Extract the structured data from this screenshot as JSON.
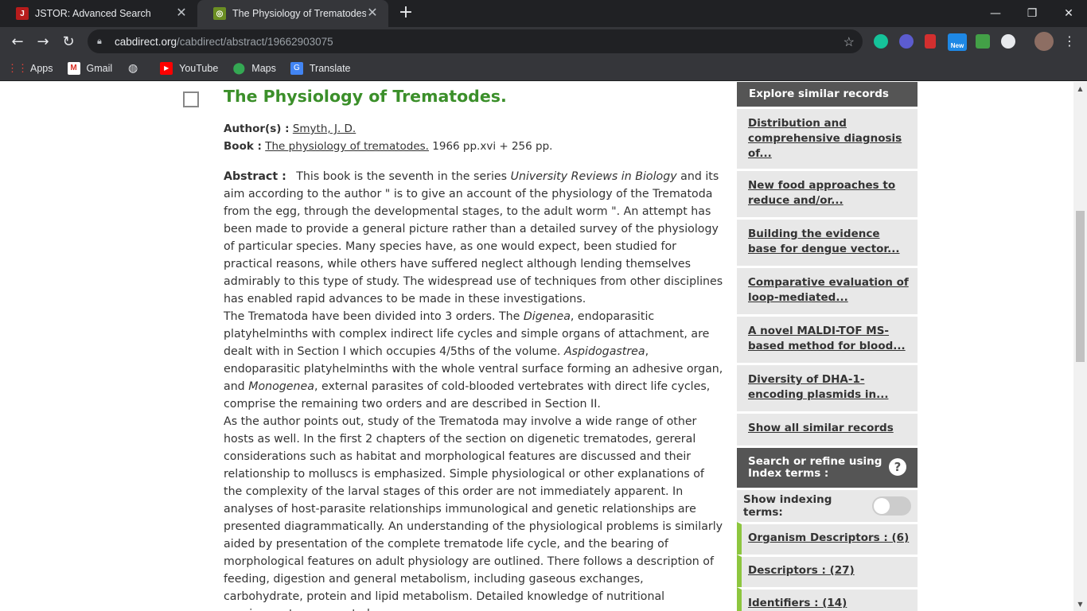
{
  "tabs": [
    {
      "title": "JSTOR: Advanced Search",
      "favicon": "jstor-icon"
    },
    {
      "title": "The Physiology of Trematodes.",
      "favicon": "cabdirect-icon"
    }
  ],
  "address": {
    "host": "cabdirect.org",
    "path": "/cabdirect/abstract/19662903075"
  },
  "bookmarks": [
    {
      "label": "Apps",
      "icon": "apps-grid-icon"
    },
    {
      "label": "Gmail",
      "icon": "gmail-icon"
    },
    {
      "label": "",
      "icon": "globe-icon"
    },
    {
      "label": "YouTube",
      "icon": "youtube-icon"
    },
    {
      "label": "Maps",
      "icon": "maps-pin-icon"
    },
    {
      "label": "Translate",
      "icon": "translate-icon"
    }
  ],
  "extensions": {
    "new_badge": "New"
  },
  "article": {
    "title": "The Physiology of Trematodes.",
    "authors_label": "Author(s) :",
    "authors": "Smyth, J. D.",
    "book_label": "Book :",
    "book_title": "The physiology of trematodes.",
    "book_details": "1966 pp.xvi + 256 pp.",
    "abstract_label": "Abstract :",
    "abstract_p1_a": "This book is the seventh in the series ",
    "abstract_p1_em": "University Reviews in Biology",
    "abstract_p1_b": " and its aim according to the author \" is to give an account of the physiology of the Trematoda from the egg, through the developmental stages, to the adult worm \". An attempt has been made to provide a general picture rather than a detailed survey of the physiology of particular species. Many species have, as one would expect, been studied for practical reasons, while others have suffered neglect although lending themselves admirably to this type of study. The widespread use of techniques from other disciplines has enabled rapid advances to be made in these investigations.",
    "abstract_p2_a": "The Trematoda have been divided into 3 orders. The ",
    "abstract_p2_em1": "Digenea",
    "abstract_p2_b": ", endoparasitic platyhelminths with complex indirect life cycles and simple organs of attachment, are dealt with in Section I which occupies 4/5ths of the volume. ",
    "abstract_p2_em2": "Aspidogastrea",
    "abstract_p2_c": ", endoparasitic platyhelminths with the whole ventral surface forming an adhesive organ, and ",
    "abstract_p2_em3": "Monogenea",
    "abstract_p2_d": ", external parasites of cold-blooded vertebrates with direct life cycles, comprise the remaining two orders and are described in Section II.",
    "abstract_p3": "As the author points out, study of the Trematoda may involve a wide range of other hosts as well. In the first 2 chapters of the section on digenetic trematodes, gereral considerations such as habitat and morphological features are discussed and their relationship to molluscs is emphasized. Simple physiological or other explanations of the complexity of the larval stages of this order are not immediately apparent. In analyses of host-parasite relationships immunological and genetic relationships are presented diagrammatically. An understanding of the physiological problems is similarly aided by presentation of the complete trematode life cycle, and the bearing of morphological features on adult physiology are outlined. There follows a description of feeding, digestion and general metabolism, including gaseous exchanges, carbohydrate, protein and lipid metabolism. Detailed knowledge of nutritional requirements appears to be"
  },
  "sidebar": {
    "similar_heading": "Explore similar records",
    "similar": [
      "Distribution and comprehensive diagnosis of...",
      "New food approaches to reduce and/or...",
      "Building the evidence base for dengue vector...",
      "Comparative evaluation of loop-mediated...",
      "A novel MALDI-TOF MS-based method for blood...",
      "Diversity of DHA-1-encoding plasmids in..."
    ],
    "show_all": "Show all similar records",
    "refine_heading": "Search or refine using Index terms :",
    "show_indexing_label": "Show indexing terms:",
    "index_links": [
      "Organism Descriptors : (6)",
      "Descriptors : (27)",
      "Identifiers : (14)"
    ]
  }
}
